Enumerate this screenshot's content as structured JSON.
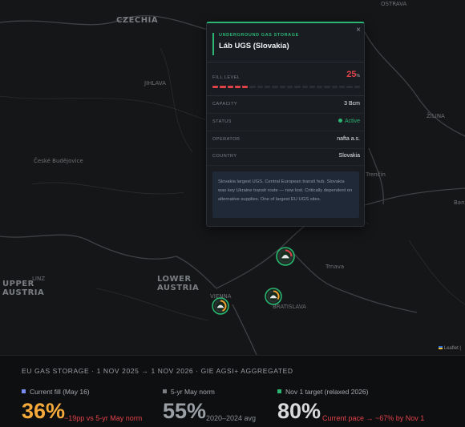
{
  "map": {
    "countries": {
      "czechia": "CZECHIA",
      "upper_austria": "UPPER\nAUSTRIA",
      "lower_austria": "LOWER\nAUSTRIA"
    },
    "cities": {
      "ostrava": "OSTRAVA",
      "jihlava": "JIHLAVA",
      "zilina": "ŽILINA",
      "ceske_budejovice": "České Budějovice",
      "trencin": "Trenčín",
      "banska": "Bans",
      "trnava": "Trnava",
      "linz": "LINZ",
      "vienna": "VIENNA",
      "bratislava": "BRATISLAVA"
    },
    "attribution": "Leaflet |"
  },
  "popup": {
    "close_label": "×",
    "eyebrow": "UNDERGROUND GAS STORAGE",
    "title": "Láb UGS (Slovakia)",
    "fill_label": "FILL LEVEL",
    "fill_value": "25",
    "fill_unit": "%",
    "fill_fraction": 0.25,
    "capacity_label": "CAPACITY",
    "capacity_value": "3 Bcm",
    "status_label": "STATUS",
    "status_value": "Active",
    "operator_label": "OPERATOR",
    "operator_value": "nafta a.s.",
    "country_label": "COUNTRY",
    "country_value": "Slovakia",
    "note": "Slovakia largest UGS. Central European transit hub. Slovakia was key Ukraine transit route — now lost. Critically dependent on alternative supplies. One of largest EU UGS sites."
  },
  "markers": [
    {
      "name": "lab",
      "fill": 0.25,
      "color": "#e0424a"
    },
    {
      "name": "vienna",
      "fill": 0.45,
      "color": "#f0a030"
    },
    {
      "name": "baumgarten",
      "fill": 0.4,
      "color": "#f0a030"
    }
  ],
  "bottom": {
    "header": "EU GAS STORAGE · 1 NOV 2025 → 1 NOV 2026 · GIE AGSI+ AGGREGATED",
    "current_label": "Current fill (May 16)",
    "current_value": "36%",
    "current_sub": "−19pp vs 5-yr May norm",
    "norm_label": "5-yr May norm",
    "norm_value": "55%",
    "norm_sub": "2020–2024 avg",
    "target_label": "Nov 1 target (relaxed 2026)",
    "target_value": "80%",
    "target_sub": "Current pace → ~67% by Nov 1",
    "colors": {
      "current": "#f4a93b",
      "norm": "#9aa0a6",
      "target": "#d9dadc",
      "warning": "#e0424a",
      "target_dot": "#2bb673",
      "current_dot": "#7b8cf0",
      "norm_dot": "#7a7d82"
    }
  }
}
